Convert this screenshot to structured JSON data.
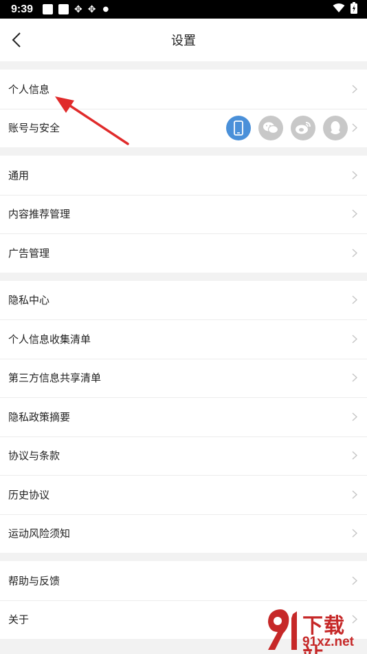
{
  "status_bar": {
    "time": "9:39"
  },
  "header": {
    "title": "设置"
  },
  "groups": [
    {
      "items": [
        {
          "label": "个人信息"
        },
        {
          "label": "账号与安全"
        }
      ]
    },
    {
      "items": [
        {
          "label": "通用"
        },
        {
          "label": "内容推荐管理"
        },
        {
          "label": "广告管理"
        }
      ]
    },
    {
      "items": [
        {
          "label": "隐私中心"
        },
        {
          "label": "个人信息收集清单"
        },
        {
          "label": "第三方信息共享清单"
        },
        {
          "label": "隐私政策摘要"
        },
        {
          "label": "协议与条款"
        },
        {
          "label": "历史协议"
        },
        {
          "label": "运动风险须知"
        }
      ]
    },
    {
      "items": [
        {
          "label": "帮助与反馈"
        },
        {
          "label": "关于"
        }
      ]
    }
  ],
  "linked_accounts": [
    {
      "icon": "phone-icon",
      "bound": true
    },
    {
      "icon": "wechat-icon",
      "bound": false
    },
    {
      "icon": "weibo-icon",
      "bound": false
    },
    {
      "icon": "qq-icon",
      "bound": false
    }
  ],
  "colors": {
    "accent": "#4a90d9",
    "inactive_icon": "#c8c8c8",
    "annotation": "#e02b2b",
    "watermark": "#c62828"
  },
  "watermark": {
    "main": "下载站",
    "sub": "91xz.net"
  }
}
